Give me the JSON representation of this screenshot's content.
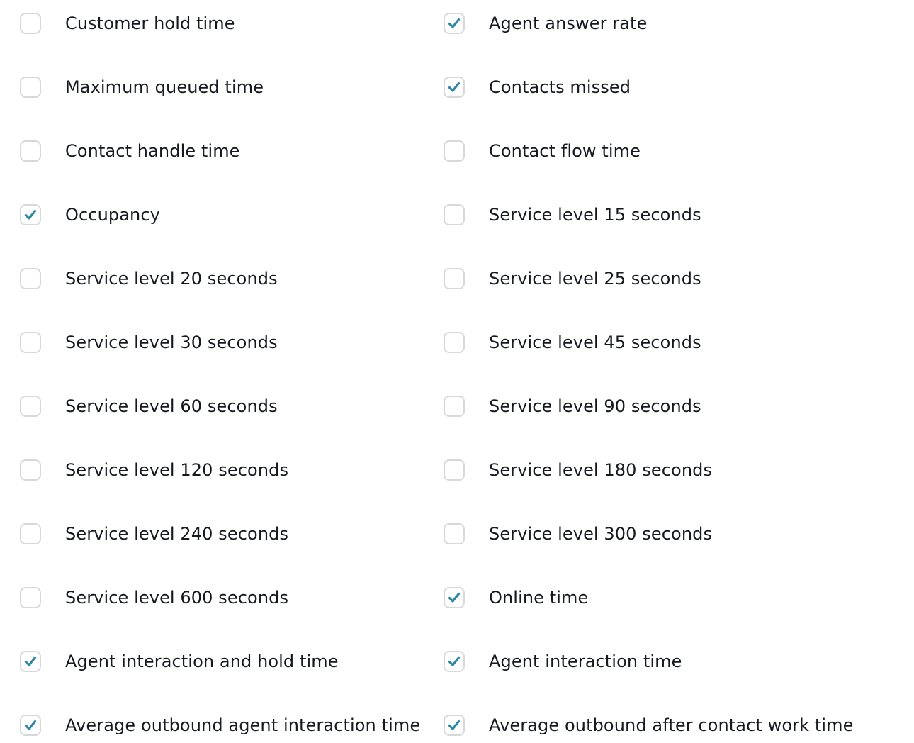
{
  "colors": {
    "check_mark": "#2b87a6",
    "box_border": "#d5d9da",
    "label_text": "#16191f"
  },
  "icons": {
    "check": "checkmark-icon"
  },
  "metrics": {
    "left": [
      {
        "label": "Customer hold time",
        "checked": false
      },
      {
        "label": "Maximum queued time",
        "checked": false
      },
      {
        "label": "Contact handle time",
        "checked": false
      },
      {
        "label": "Occupancy",
        "checked": true
      },
      {
        "label": "Service level 20 seconds",
        "checked": false
      },
      {
        "label": "Service level 30 seconds",
        "checked": false
      },
      {
        "label": "Service level 60 seconds",
        "checked": false
      },
      {
        "label": "Service level 120 seconds",
        "checked": false
      },
      {
        "label": "Service level 240 seconds",
        "checked": false
      },
      {
        "label": "Service level 600 seconds",
        "checked": false
      },
      {
        "label": "Agent interaction and hold time",
        "checked": true
      },
      {
        "label": "Average outbound agent interaction time",
        "checked": true
      }
    ],
    "right": [
      {
        "label": "Agent answer rate",
        "checked": true
      },
      {
        "label": "Contacts missed",
        "checked": true
      },
      {
        "label": "Contact flow time",
        "checked": false
      },
      {
        "label": "Service level 15 seconds",
        "checked": false
      },
      {
        "label": "Service level 25 seconds",
        "checked": false
      },
      {
        "label": "Service level 45 seconds",
        "checked": false
      },
      {
        "label": "Service level 90 seconds",
        "checked": false
      },
      {
        "label": "Service level 180 seconds",
        "checked": false
      },
      {
        "label": "Service level 300 seconds",
        "checked": false
      },
      {
        "label": "Online time",
        "checked": true
      },
      {
        "label": "Agent interaction time",
        "checked": true
      },
      {
        "label": "Average outbound after contact work time",
        "checked": true
      }
    ]
  }
}
